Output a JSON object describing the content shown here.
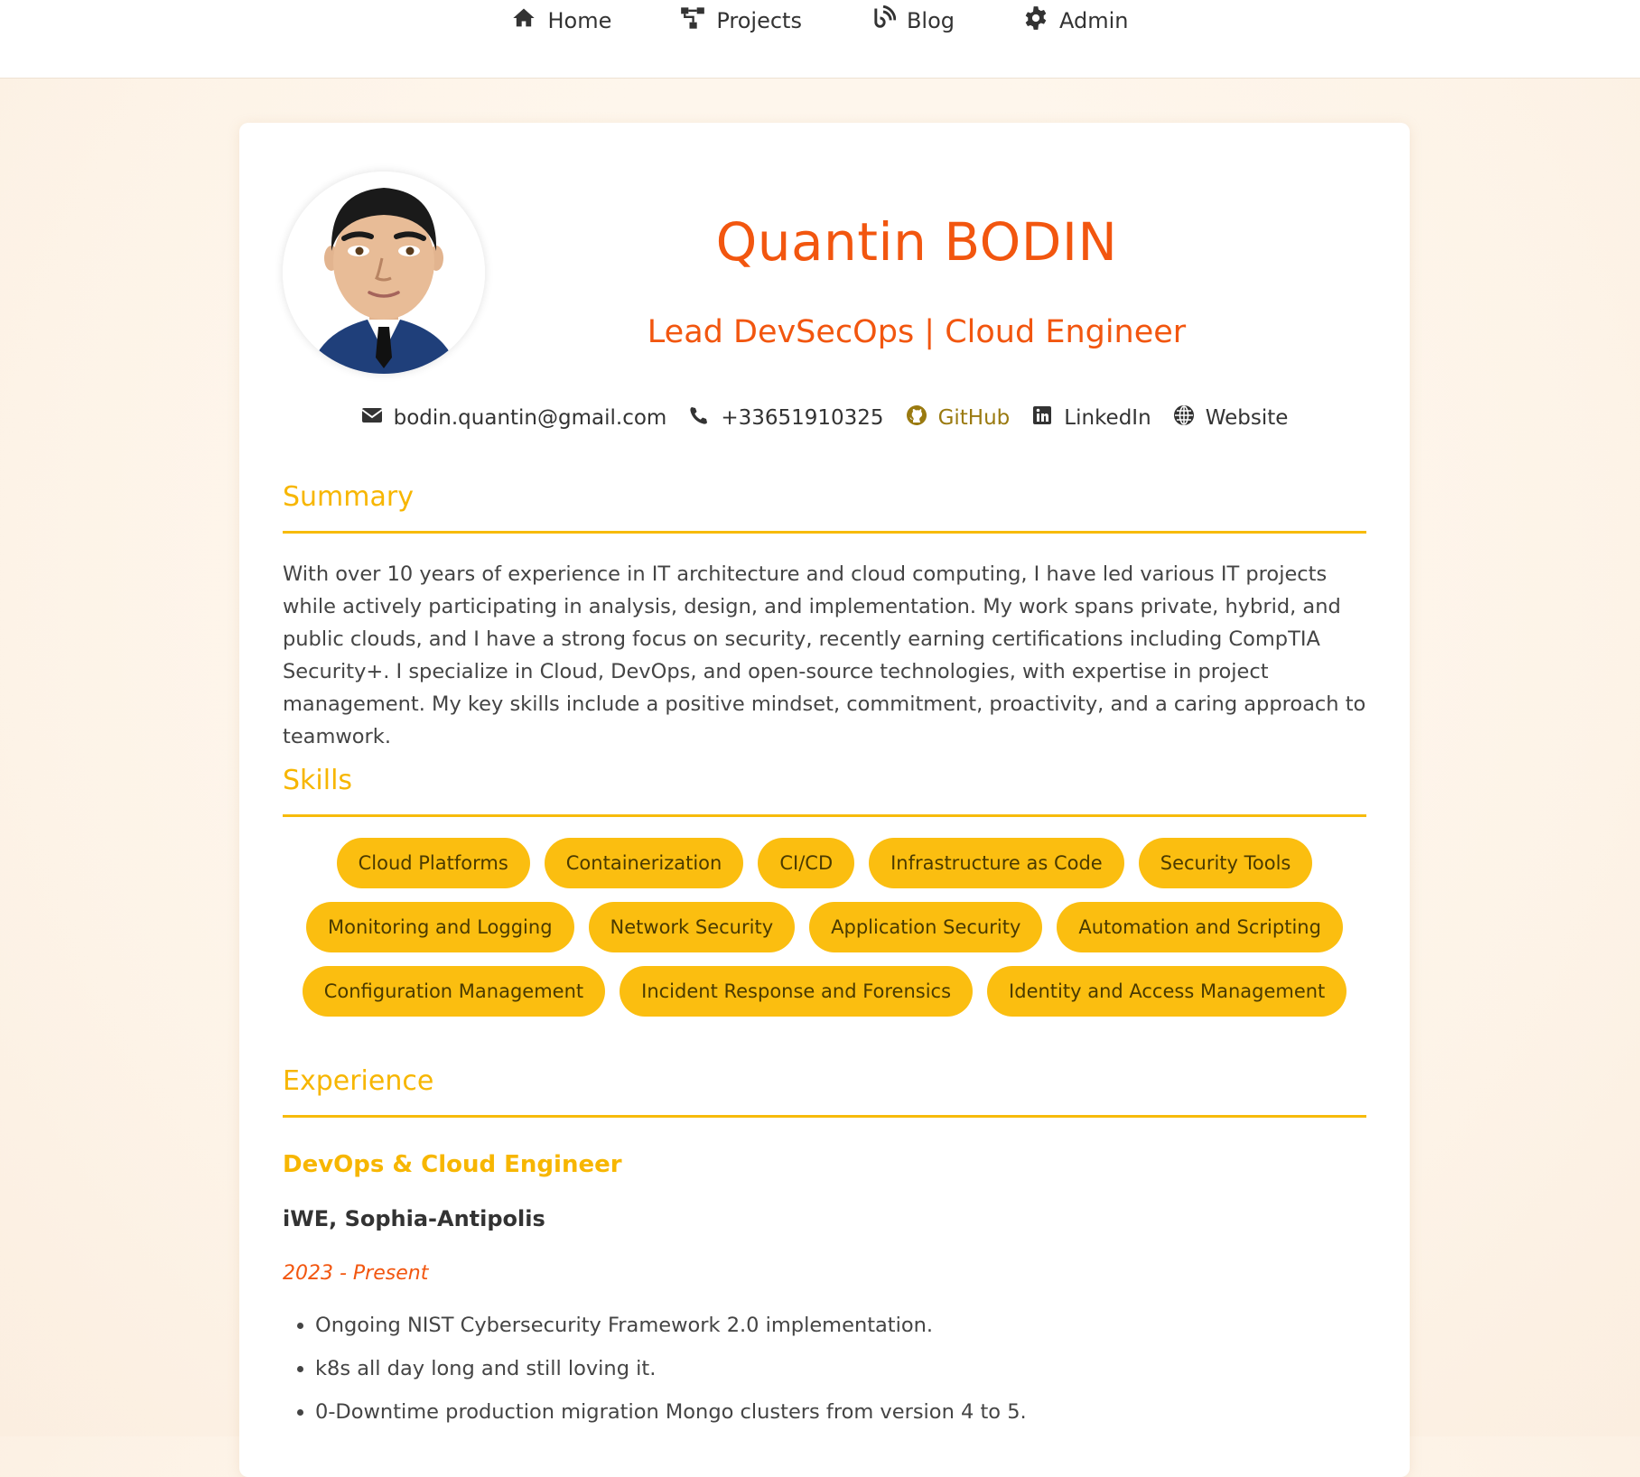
{
  "nav": {
    "items": [
      {
        "label": "Home",
        "icon": "home-icon"
      },
      {
        "label": "Projects",
        "icon": "sitemap-icon"
      },
      {
        "label": "Blog",
        "icon": "blog-icon"
      },
      {
        "label": "Admin",
        "icon": "gear-icon"
      }
    ]
  },
  "profile": {
    "name": "Quantin BODIN",
    "title": "Lead DevSecOps | Cloud Engineer",
    "avatar_icon": "cartoon-avatar"
  },
  "contacts": [
    {
      "label": "bodin.quantin@gmail.com",
      "icon": "envelope-icon"
    },
    {
      "label": "+33651910325",
      "icon": "phone-icon"
    },
    {
      "label": "GitHub",
      "icon": "github-icon"
    },
    {
      "label": "LinkedIn",
      "icon": "linkedin-icon"
    },
    {
      "label": "Website",
      "icon": "globe-icon"
    }
  ],
  "summary": {
    "heading": "Summary",
    "text": "With over 10 years of experience in IT architecture and cloud computing, I have led various IT projects while actively participating in analysis, design, and implementation. My work spans private, hybrid, and public clouds, and I have a strong focus on security, recently earning certifications including CompTIA Security+. I specialize in Cloud, DevOps, and open-source technologies, with expertise in project management. My key skills include a positive mindset, commitment, proactivity, and a caring approach to teamwork."
  },
  "skills": {
    "heading": "Skills",
    "items": [
      "Cloud Platforms",
      "Containerization",
      "CI/CD",
      "Infrastructure as Code",
      "Security Tools",
      "Monitoring and Logging",
      "Network Security",
      "Application Security",
      "Automation and Scripting",
      "Configuration Management",
      "Incident Response and Forensics",
      "Identity and Access Management"
    ]
  },
  "experience": {
    "heading": "Experience",
    "jobs": [
      {
        "title": "DevOps & Cloud Engineer",
        "company": "iWE, Sophia-Antipolis",
        "dates": "2023 - Present",
        "bullets": [
          "Ongoing NIST Cybersecurity Framework 2.0 implementation.",
          "k8s all day long and still loving it.",
          "0-Downtime production migration Mongo clusters from version 4 to 5."
        ]
      }
    ]
  },
  "colors": {
    "accent_orange": "#f2560f",
    "accent_yellow": "#f7b600",
    "pill_bg": "#fbbe10"
  }
}
